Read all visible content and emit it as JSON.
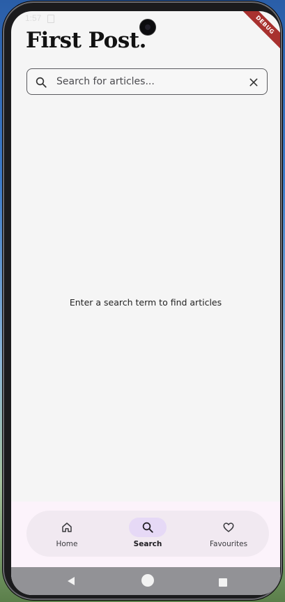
{
  "status_bar": {
    "time": "1:57"
  },
  "debug_banner": "DEBUG",
  "app": {
    "title": "First Post."
  },
  "search": {
    "placeholder": "Search for articles...",
    "value": "",
    "search_icon": "search-icon",
    "clear_icon": "close-icon"
  },
  "empty_state": {
    "message": "Enter a search term to find articles"
  },
  "bottom_nav": {
    "active": "Search",
    "items": [
      {
        "label": "Home",
        "icon": "home-icon"
      },
      {
        "label": "Search",
        "icon": "search-icon"
      },
      {
        "label": "Favourites",
        "icon": "heart-icon"
      }
    ]
  },
  "system_nav": {
    "buttons": [
      "back-icon",
      "home-circle-icon",
      "recents-icon"
    ]
  },
  "colors": {
    "background": "#f5f5f5",
    "nav_bar": "#fcf3fb",
    "nav_pill": "#f1e9f1",
    "active_indicator": "#e6d9f6",
    "debug_ribbon": "#a8312f"
  }
}
